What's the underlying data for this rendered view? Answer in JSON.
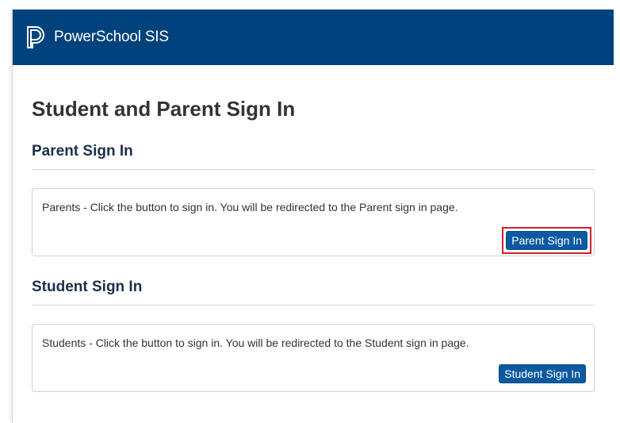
{
  "header": {
    "brand": "PowerSchool SIS",
    "logo_icon": "powerschool-logo-icon",
    "background": "#00427c"
  },
  "page": {
    "title": "Student and Parent Sign In"
  },
  "parent": {
    "heading": "Parent Sign In",
    "description": "Parents - Click the button to sign in. You will be redirected to the Parent sign in page.",
    "button_label": "Parent Sign In",
    "highlighted": true,
    "highlight_color": "#d0202a"
  },
  "student": {
    "heading": "Student Sign In",
    "description": "Students - Click the button to sign in. You will be redirected to the Student sign in page.",
    "button_label": "Student Sign In"
  },
  "colors": {
    "button": "#0b5aa1",
    "heading": "#1b2f4b"
  }
}
